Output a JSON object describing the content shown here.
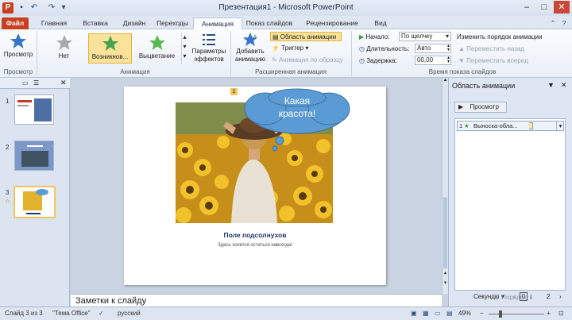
{
  "window": {
    "title": "Презентация1 - Microsoft PowerPoint",
    "controls": [
      "minimize",
      "maximize",
      "close"
    ]
  },
  "tabs": [
    "Файл",
    "Главная",
    "Вставка",
    "Дизайн",
    "Переходы",
    "Анимация",
    "Показ слайдов",
    "Рецензирование",
    "Вид"
  ],
  "active_tab": "Анимация",
  "ribbon": {
    "preview": {
      "label": "Просмотр",
      "group": "Просмотр"
    },
    "animation": {
      "group": "Анимация",
      "items": [
        "Нет",
        "Возникнов...",
        "Выцветание"
      ],
      "selected": "Возникнов...",
      "effect_params": [
        "Параметры",
        "эффектов"
      ]
    },
    "advanced": {
      "group": "Расширенная анимация",
      "add_animation": [
        "Добавить",
        "анимацию"
      ],
      "anim_pane": "Область анимации",
      "trigger": "Триггер",
      "painter": "Анимация по образцу"
    },
    "timing": {
      "group": "Время показа слайдов",
      "start_label": "Начало:",
      "start_value": "По щелчку",
      "duration_label": "Длительность:",
      "duration_value": "Авто",
      "delay_label": "Задержка:",
      "delay_value": "00,00",
      "reorder_title": "Изменить порядок анимации",
      "move_back": "Переместить назад",
      "move_forward": "Переместить вперед"
    }
  },
  "slides_panel": {
    "slides": [
      "1",
      "2",
      "3"
    ],
    "selected": 3
  },
  "slide": {
    "callout_text": "Какая красота!",
    "caption": "Поле подсолнухов",
    "subcaption": "Здесь хочется остаться навсегда!",
    "anim_marker": "1"
  },
  "notes": {
    "placeholder": "Заметки к слайду"
  },
  "anim_pane": {
    "title": "Область анимации",
    "play": "Просмотр",
    "items": [
      {
        "index": "1",
        "name": "Выноска-обла..."
      }
    ],
    "seconds_label": "Секунды",
    "timeline_start": "0",
    "timeline_end": "2",
    "order_label": "Порядок"
  },
  "status": {
    "slide_info": "Слайд 3 из 3",
    "theme": "\"Тема Office\"",
    "language": "русский",
    "zoom": "49%"
  },
  "colors": {
    "file_tab": "#c8401f",
    "accent_select": "#fbe29a",
    "ribbon_bg": "#fbfcfe"
  }
}
